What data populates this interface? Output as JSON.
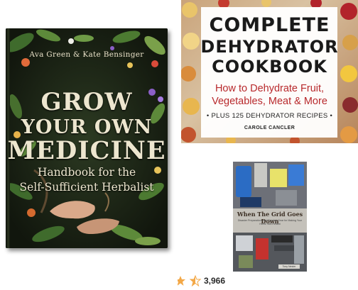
{
  "books": [
    {
      "author": "Ava Green & Kate Bensinger",
      "title_lines": [
        "GROW",
        "YOUR OWN",
        "MEDICINE"
      ],
      "subtitle_lines": [
        "Handbook for the",
        "Self-Sufficient Herbalist"
      ]
    },
    {
      "title_lines": [
        "COMPLETE",
        "DEHYDRATOR",
        "COOKBOOK"
      ],
      "subtitle_lines": [
        "How to Dehydrate Fruit,",
        "Vegetables, Meat & More"
      ],
      "tagline": "• PLUS 125 DEHYDRATOR RECIPES •",
      "author": "CAROLE CANCLER",
      "accent_color": "#b8292c"
    },
    {
      "title": "When The Grid Goes Down",
      "subtitle": "Disaster Preparations and Survival Gear for Making Your Home Self-Reliant",
      "author": "Tony Nester"
    }
  ],
  "rating": {
    "count": "3,966",
    "star_color": "#f3a847",
    "stars_visible": 1.5
  }
}
